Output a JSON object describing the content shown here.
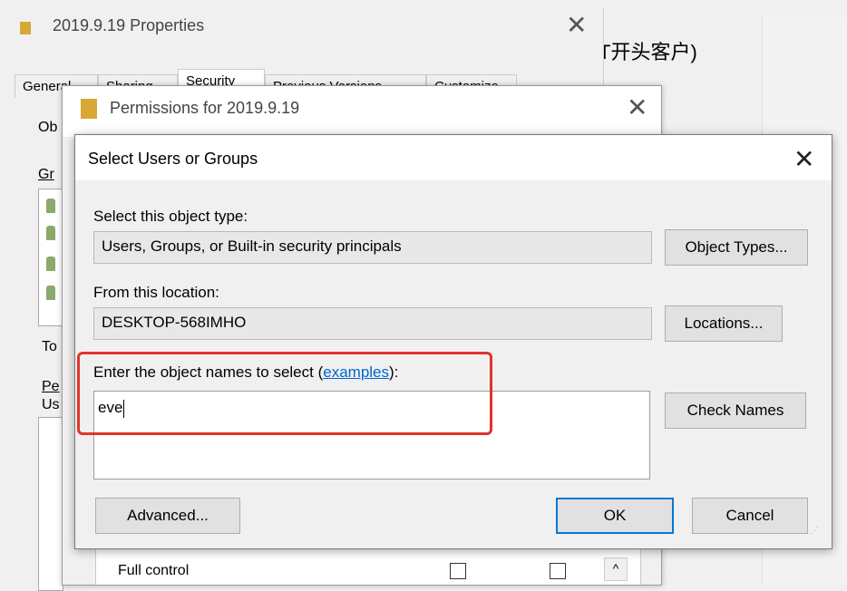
{
  "background": {
    "cn_text": "T开头客户)"
  },
  "properties_window": {
    "title": "2019.9.19 Properties",
    "tabs": [
      "General",
      "Sharing",
      "Security",
      "Previous Versions",
      "Customize"
    ],
    "active_tab": "Security",
    "cut_labels": [
      "Ob",
      "Gr",
      "To",
      "Pe",
      "Us"
    ]
  },
  "permissions_window": {
    "title": "Permissions for 2019.9.19",
    "row_label": "Full control"
  },
  "dialog": {
    "title": "Select Users or Groups",
    "object_type_label": "Select this object type:",
    "object_type_value": "Users, Groups, or Built-in security principals",
    "object_types_button": "Object Types...",
    "location_label": "From this location:",
    "location_value": "DESKTOP-568IMHO",
    "locations_button": "Locations...",
    "names_label_prefix": "Enter the object names to select (",
    "names_label_link": "examples",
    "names_label_suffix": "):",
    "names_value": "eve",
    "check_names_button": "Check Names",
    "advanced_button": "Advanced...",
    "ok_button": "OK",
    "cancel_button": "Cancel"
  },
  "colors": {
    "highlight": "#e0342c",
    "default_button_border": "#0078d7",
    "link": "#0066cc"
  }
}
